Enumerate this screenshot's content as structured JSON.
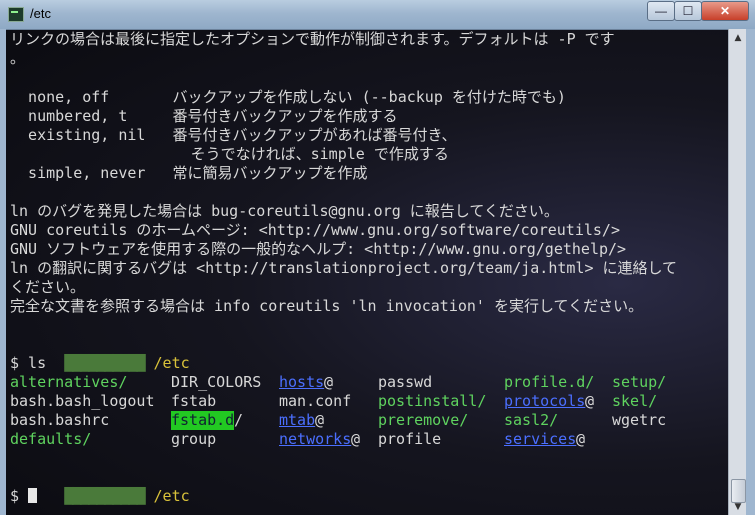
{
  "window": {
    "title": "/etc",
    "controls": {
      "min": "—",
      "max": "☐",
      "close": "✕"
    }
  },
  "terminal": {
    "lines": [
      "リンクの場合は最後に指定したオプションで動作が制御されます。デフォルトは -P です",
      "。",
      "",
      "  none, off       バックアップを作成しない (--backup を付けた時でも)",
      "  numbered, t     番号付きバックアップを作成する",
      "  existing, nil   番号付きバックアップがあれば番号付き、",
      "                    そうでなければ、simple で作成する",
      "  simple, never   常に簡易バックアップを作成",
      "",
      "ln のバグを発見した場合は bug-coreutils@gnu.org に報告してください。",
      "GNU coreutils のホームページ: <http://www.gnu.org/software/coreutils/>",
      "GNU ソフトウェアを使用する際の一般的なヘルプ: <http://www.gnu.org/gethelp/>",
      "ln の翻訳に関するバグは <http://translationproject.org/team/ja.html> に連絡して",
      "ください。",
      "完全な文書を参照する場合は info coreutils 'ln invocation' を実行してください。"
    ],
    "prompt1": {
      "user": "██████████",
      "path": "/etc"
    },
    "command": "$ ls",
    "ls": {
      "row1": [
        "alternatives/",
        "DIR_COLORS",
        "hosts",
        "@",
        "passwd",
        "profile.d/",
        "setup/"
      ],
      "row2": [
        "bash.bash_logout",
        "fstab",
        "man.conf",
        "postinstall/",
        "protocols",
        "@",
        "skel/"
      ],
      "row3": [
        "bash.bashrc",
        "fstab.d",
        "/",
        "mtab",
        "@",
        "preremove/",
        "sasl2/",
        "wgetrc"
      ],
      "row4": [
        "defaults/",
        "group",
        "networks",
        "@",
        "profile",
        "services",
        "@"
      ]
    },
    "prompt2": {
      "user": "██████████",
      "path": "/etc"
    },
    "final_prompt": "$ "
  },
  "scrollbar": {
    "up": "▲",
    "down": "▼"
  }
}
